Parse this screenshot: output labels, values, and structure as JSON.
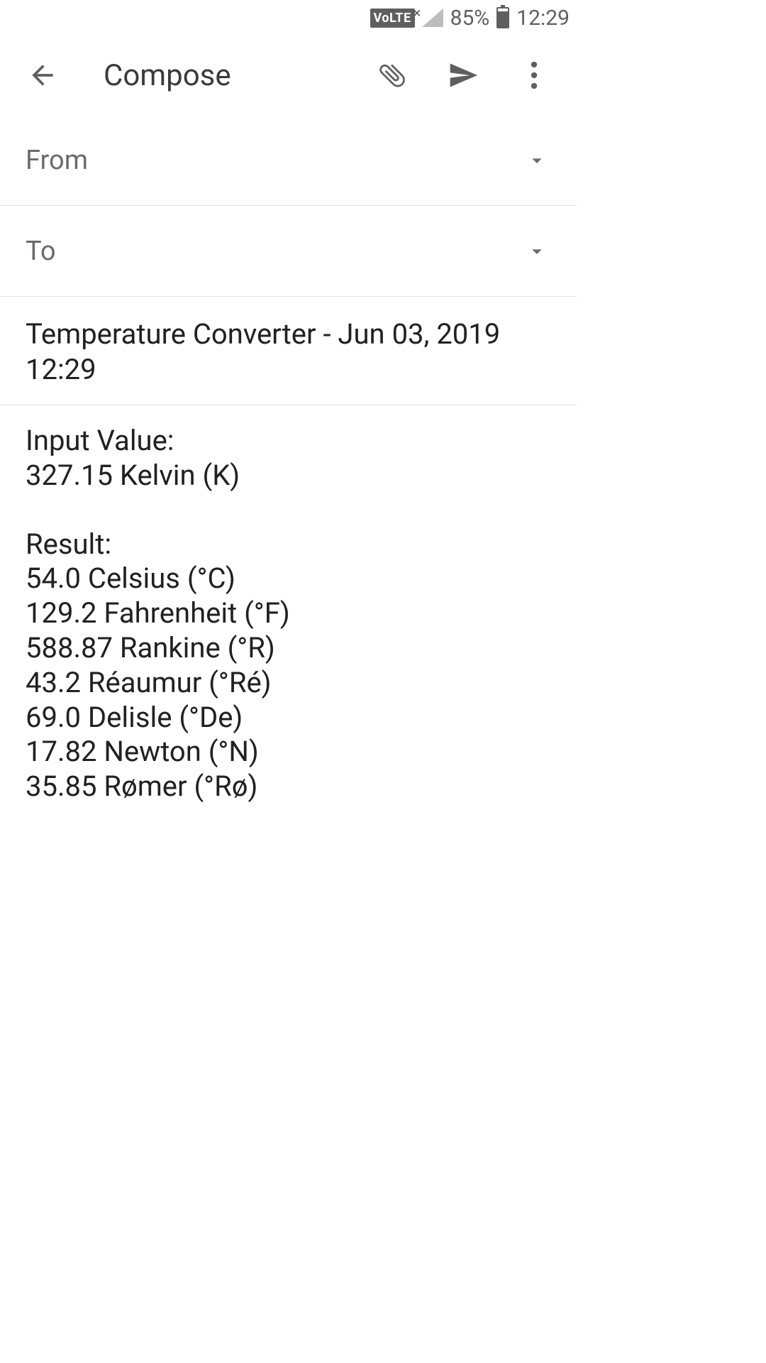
{
  "status_bar": {
    "volte": "VoLTE",
    "battery_percent": "85%",
    "time": "12:29"
  },
  "app_bar": {
    "title": "Compose"
  },
  "fields": {
    "from_label": "From",
    "to_label": "To"
  },
  "subject": "Temperature Converter - Jun 03, 2019 12:29",
  "body": {
    "input_label": "Input Value:",
    "input_value": "327.15 Kelvin (K)",
    "result_label": "Result:",
    "results": [
      "54.0 Celsius (°C)",
      "129.2 Fahrenheit (°F)",
      "588.87 Rankine (°R)",
      "43.2 Réaumur (°Ré)",
      "69.0 Delisle (°De)",
      "17.82 Newton (°N)",
      "35.85 Rømer (°Rø)"
    ]
  }
}
